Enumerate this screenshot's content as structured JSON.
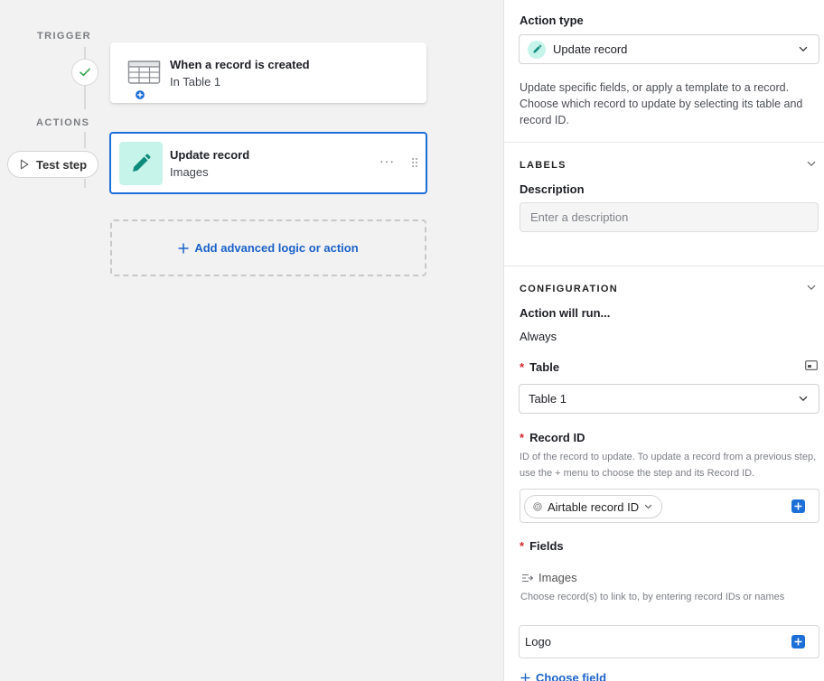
{
  "canvas": {
    "trigger_label": "TRIGGER",
    "actions_label": "ACTIONS",
    "test_step_label": "Test step",
    "trigger_card": {
      "title": "When a record is created",
      "subtitle": "In Table 1",
      "icon": "table-icon"
    },
    "action_card": {
      "title": "Update record",
      "subtitle": "Images",
      "icon": "pencil-icon",
      "more": "···"
    },
    "add_button_label": "Add advanced logic or action"
  },
  "panel": {
    "action_type_label": "Action type",
    "action_type_value": "Update record",
    "action_type_description": "Update specific fields, or apply a template to a record. Choose which record to update by selecting its table and record ID.",
    "labels_section": "LABELS",
    "description_label": "Description",
    "description_placeholder": "Enter a description",
    "configuration_section": "CONFIGURATION",
    "action_will_run_label": "Action will run...",
    "action_will_run_value": "Always",
    "table_label": "Table",
    "table_value": "Table 1",
    "record_id_label": "Record ID",
    "record_id_hint": "ID of the record to update. To update a record from a previous step, use the + menu to choose the step and its Record ID.",
    "record_id_token": "Airtable record ID",
    "fields_label": "Fields",
    "field_name": "Images",
    "field_hint": "Choose record(s) to link to, by entering record IDs or names",
    "field_value": "Logo",
    "choose_field_label": "Choose field",
    "required_mark": "*"
  },
  "colors": {
    "accent": "#1d6fd8",
    "action_icon_bg": "#c6f4ea",
    "action_icon_fg": "#0e8c7b",
    "required": "#d4272c",
    "success": "#2ea34d"
  }
}
